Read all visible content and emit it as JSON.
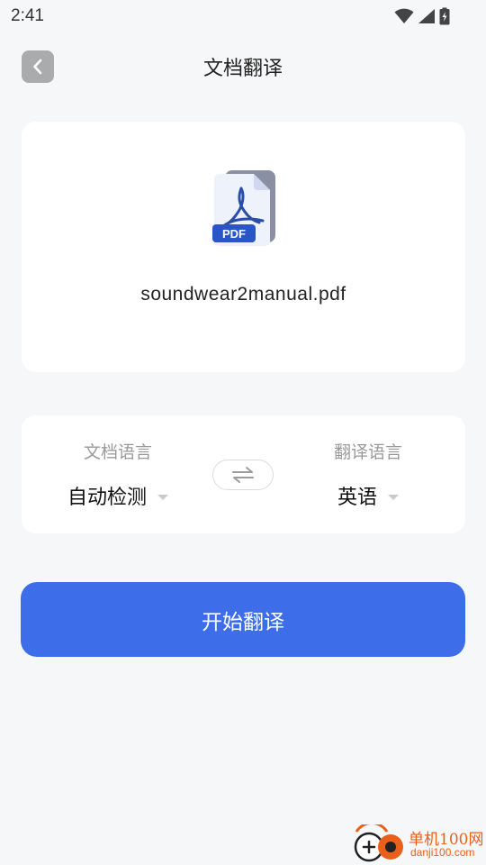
{
  "status_bar": {
    "time": "2:41"
  },
  "header": {
    "title": "文档翻译"
  },
  "file_card": {
    "file_name": "soundwear2manual.pdf",
    "file_type_badge": "PDF"
  },
  "languages": {
    "source_caption": "文档语言",
    "source_value": "自动检测",
    "target_caption": "翻译语言",
    "target_value": "英语"
  },
  "actions": {
    "start_label": "开始翻译"
  },
  "watermark": {
    "line1": "单机100网",
    "line2": "danji100.com"
  },
  "colors": {
    "primary": "#3d6de9",
    "background": "#f6f7f8",
    "card": "#ffffff",
    "watermark": "#e8601c"
  }
}
